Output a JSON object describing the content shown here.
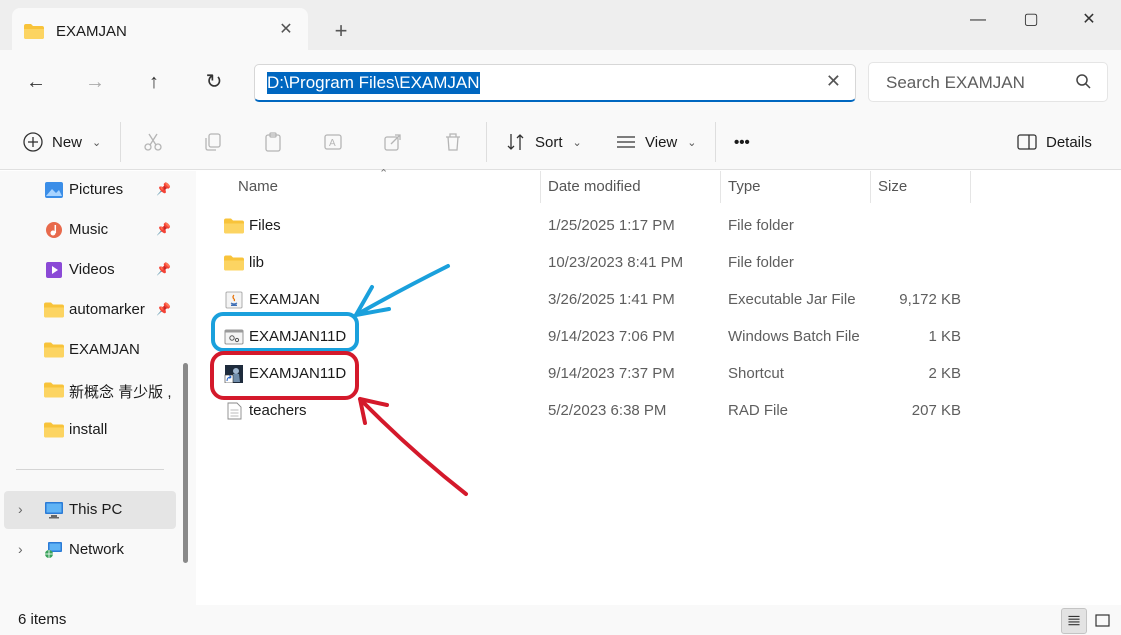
{
  "window": {
    "tab_title": "EXAMJAN",
    "new_tab": "+",
    "minimize": "—",
    "maximize": "▢",
    "close": "✕"
  },
  "address": {
    "path": "D:\\Program Files\\EXAMJAN",
    "search_placeholder": "Search EXAMJAN"
  },
  "toolbar": {
    "new_label": "New",
    "sort_label": "Sort",
    "view_label": "View",
    "more_label": "•••",
    "details_label": "Details"
  },
  "sidebar": {
    "items": [
      {
        "label": "Pictures",
        "pinned": true
      },
      {
        "label": "Music",
        "pinned": true
      },
      {
        "label": "Videos",
        "pinned": true
      },
      {
        "label": "automarker",
        "pinned": true
      },
      {
        "label": "EXAMJAN",
        "pinned": false
      },
      {
        "label": "新概念 青少版 ,",
        "pinned": false
      },
      {
        "label": "install",
        "pinned": false
      },
      {
        "label": "This PC",
        "pinned": false
      },
      {
        "label": "Network",
        "pinned": false
      }
    ]
  },
  "columns": {
    "name": "Name",
    "date": "Date modified",
    "type": "Type",
    "size": "Size"
  },
  "files": [
    {
      "name": "Files",
      "date": "1/25/2025 1:17 PM",
      "type": "File folder",
      "size": "",
      "icon": "folder-icon"
    },
    {
      "name": "lib",
      "date": "10/23/2023 8:41 PM",
      "type": "File folder",
      "size": "",
      "icon": "folder-icon"
    },
    {
      "name": "EXAMJAN",
      "date": "3/26/2025 1:41 PM",
      "type": "Executable Jar File",
      "size": "9,172 KB",
      "icon": "java-jar-icon"
    },
    {
      "name": "EXAMJAN11D",
      "date": "9/14/2023 7:06 PM",
      "type": "Windows Batch File",
      "size": "1 KB",
      "icon": "batch-file-icon"
    },
    {
      "name": "EXAMJAN11D",
      "date": "9/14/2023 7:37 PM",
      "type": "Shortcut",
      "size": "2 KB",
      "icon": "shortcut-icon"
    },
    {
      "name": "teachers",
      "date": "5/2/2023 6:38 PM",
      "type": "RAD File",
      "size": "207 KB",
      "icon": "document-icon"
    }
  ],
  "status": {
    "item_count": "6 items"
  },
  "colors": {
    "accent": "#0067c0",
    "annotation_blue": "#1aa0dc",
    "annotation_red": "#d4192b"
  }
}
